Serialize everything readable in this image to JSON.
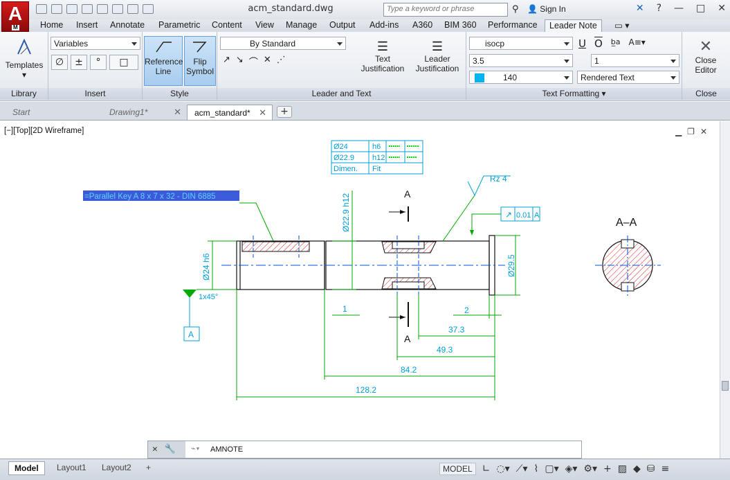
{
  "app": {
    "logo_letter": "A",
    "logo_sub": "M"
  },
  "window": {
    "title": "acm_standard.dwg",
    "search_placeholder": "Type a keyword or phrase",
    "sign_in": "Sign In"
  },
  "ribbon_tabs": [
    "Home",
    "Insert",
    "Annotate",
    "Parametric",
    "Content",
    "View",
    "Manage",
    "Output",
    "Add-ins",
    "A360",
    "BIM 360",
    "Performance",
    "Leader Note"
  ],
  "panels": {
    "library": {
      "title": "Library",
      "templates": "Templates"
    },
    "insert": {
      "title": "Insert",
      "variables": "Variables",
      "symbols": [
        "∅",
        "±",
        "°",
        "□"
      ]
    },
    "style": {
      "title": "Style",
      "reference_line": "Reference Line",
      "flip_symbol": "Flip Symbol"
    },
    "leader_text": {
      "title": "Leader and Text",
      "by_standard": "By Standard",
      "text_just": "Text Justification",
      "leader_just": "Leader Justification"
    },
    "text_formatting": {
      "title": "Text Formatting",
      "font": "isocp",
      "height": "3.5",
      "color": "140",
      "width_factor": "1",
      "rendered": "Rendered Text"
    },
    "close": {
      "title": "Close",
      "close_editor": "Close Editor"
    }
  },
  "file_tabs": [
    {
      "label": "Start"
    },
    {
      "label": "Drawing1*"
    },
    {
      "label": "acm_standard*"
    }
  ],
  "viewport": {
    "label": "[−][Top][2D Wireframe]"
  },
  "drawing": {
    "table": [
      [
        "Ø24",
        "h6"
      ],
      [
        "Ø22.9",
        "h12"
      ],
      [
        "Dimen.",
        "Fit"
      ]
    ],
    "note": "=Parallel Key  A 8 x 7 x 32 - DIN 6885",
    "section_label": "A",
    "section_title": "A–A",
    "roughness": "Rz 4",
    "tolerance": "0.01",
    "datum": "A",
    "chamfer": "1x45°",
    "dims": {
      "d229": "Ø22.9 h12",
      "d24": "Ø24 h6",
      "d295": "Ø29.5",
      "one": "1",
      "two": "2",
      "d373": "37.3",
      "d493": "49.3",
      "d842": "84.2",
      "d1282": "128.2"
    }
  },
  "command": {
    "text": "AMNOTE"
  },
  "layout_tabs": [
    "Model",
    "Layout1",
    "Layout2"
  ],
  "status": {
    "model": "MODEL"
  },
  "colors": {
    "dim": "#00aa00",
    "text": "#00a0d8",
    "hatch": "#e02020",
    "center": "#0050e0"
  }
}
